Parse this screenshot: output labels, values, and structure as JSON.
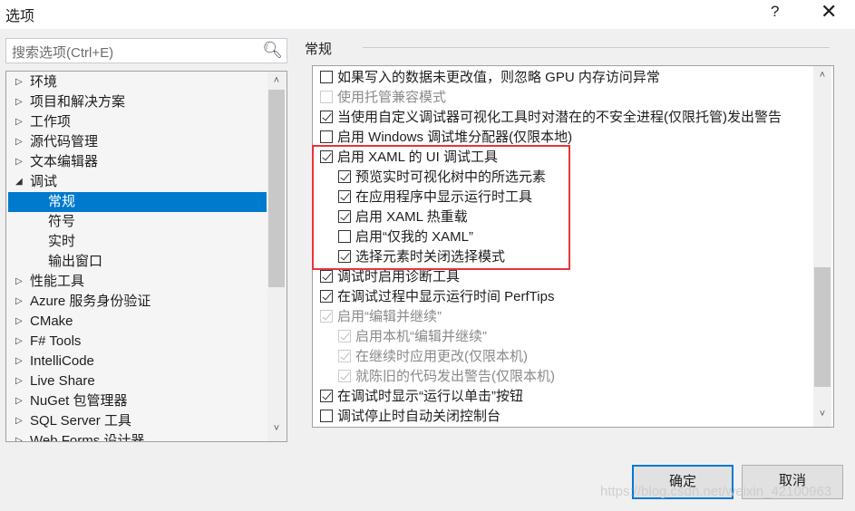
{
  "window": {
    "title": "选项",
    "help": "?",
    "close": "✕"
  },
  "search": {
    "placeholder": "搜索选项(Ctrl+E)",
    "icon": "search-icon"
  },
  "tree": [
    {
      "label": "环境",
      "state": "collapsed"
    },
    {
      "label": "项目和解决方案",
      "state": "collapsed"
    },
    {
      "label": "工作项",
      "state": "collapsed"
    },
    {
      "label": "源代码管理",
      "state": "collapsed"
    },
    {
      "label": "文本编辑器",
      "state": "collapsed"
    },
    {
      "label": "调试",
      "state": "expanded"
    },
    {
      "label": "常规",
      "state": "child",
      "selected": true
    },
    {
      "label": "符号",
      "state": "child"
    },
    {
      "label": "实时",
      "state": "child"
    },
    {
      "label": "输出窗口",
      "state": "child"
    },
    {
      "label": "性能工具",
      "state": "collapsed"
    },
    {
      "label": "Azure 服务身份验证",
      "state": "collapsed"
    },
    {
      "label": "CMake",
      "state": "collapsed"
    },
    {
      "label": "F# Tools",
      "state": "collapsed"
    },
    {
      "label": "IntelliCode",
      "state": "collapsed"
    },
    {
      "label": "Live Share",
      "state": "collapsed"
    },
    {
      "label": "NuGet 包管理器",
      "state": "collapsed"
    },
    {
      "label": "SQL Server 工具",
      "state": "collapsed"
    },
    {
      "label": "Web Forms 设计器",
      "state": "collapsed"
    }
  ],
  "section": {
    "title": "常规"
  },
  "options": [
    {
      "label": "如果写入的数据未更改值，则忽略 GPU 内存访问异常",
      "checked": false,
      "indent": 0
    },
    {
      "label": "使用托管兼容模式",
      "checked": false,
      "indent": 0,
      "disabled": true
    },
    {
      "label": "当使用自定义调试器可视化工具时对潜在的不安全进程(仅限托管)发出警告",
      "checked": true,
      "indent": 0
    },
    {
      "label": "启用 Windows 调试堆分配器(仅限本地)",
      "checked": false,
      "indent": 0
    },
    {
      "label": "启用 XAML 的 UI 调试工具",
      "checked": true,
      "indent": 0
    },
    {
      "label": "预览实时可视化树中的所选元素",
      "checked": true,
      "indent": 1
    },
    {
      "label": "在应用程序中显示运行时工具",
      "checked": true,
      "indent": 1
    },
    {
      "label": "启用 XAML 热重载",
      "checked": true,
      "indent": 1
    },
    {
      "label": "启用“仅我的 XAML”",
      "checked": false,
      "indent": 1
    },
    {
      "label": "选择元素时关闭选择模式",
      "checked": true,
      "indent": 1
    },
    {
      "label": "调试时启用诊断工具",
      "checked": true,
      "indent": 0
    },
    {
      "label": "在调试过程中显示运行时间 PerfTips",
      "checked": true,
      "indent": 0
    },
    {
      "label": "启用“编辑并继续”",
      "checked": true,
      "indent": 0,
      "disabled": true
    },
    {
      "label": "启用本机“编辑并继续”",
      "checked": true,
      "indent": 1,
      "disabled": true
    },
    {
      "label": "在继续时应用更改(仅限本机)",
      "checked": true,
      "indent": 1,
      "disabled": true
    },
    {
      "label": "就陈旧的代码发出警告(仅限本机)",
      "checked": true,
      "indent": 1,
      "disabled": true
    },
    {
      "label": "在调试时显示“运行以单击”按钮",
      "checked": true,
      "indent": 0
    },
    {
      "label": "调试停止时自动关闭控制台",
      "checked": false,
      "indent": 0
    }
  ],
  "buttons": {
    "ok": "确定",
    "cancel": "取消"
  },
  "colors": {
    "selection": "#007acc",
    "highlight_box": "#e8343a",
    "default_button_border": "#0078d7"
  },
  "watermark": "https://blog.csdn.net/weixin_42100963"
}
